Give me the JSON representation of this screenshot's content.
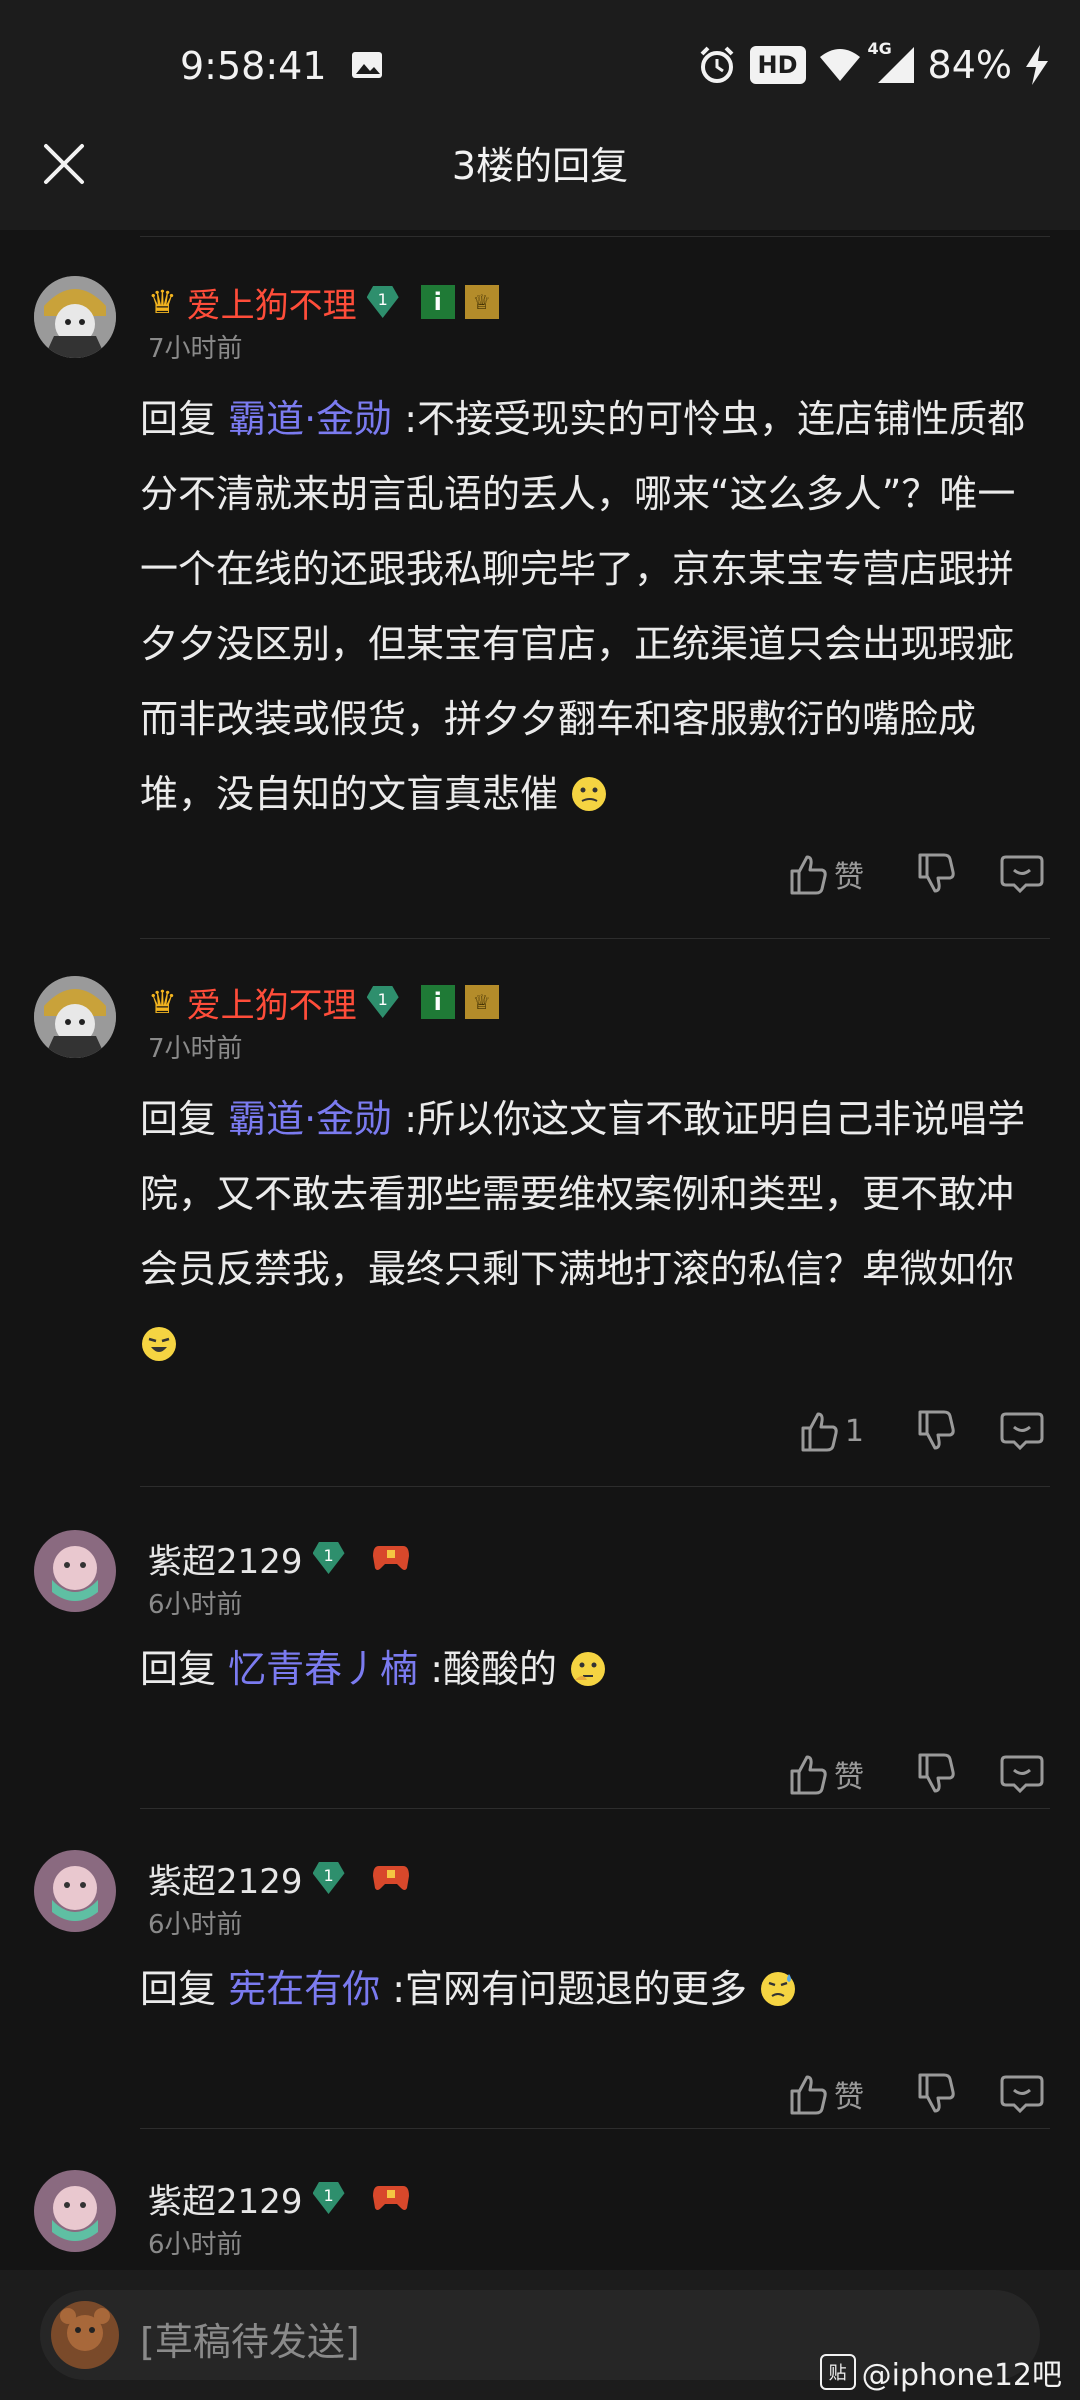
{
  "status_bar": {
    "time": "9:58:41",
    "hd": "HD",
    "net": "4G",
    "battery": "84%"
  },
  "header": {
    "title": "3楼的回复"
  },
  "posts": [
    {
      "username": "爱上狗不理",
      "time": "7小时前",
      "prefix": "回复 ",
      "mention": "霸道·金勋",
      "text": " :不接受现实的可怜虫，连店铺性质都分不清就来胡言乱语的丢人，哪来“这么多人”？唯一一个在线的还跟我私聊完毕了，京东某宝专营店跟拼夕夕没区别，但某宝有官店，正统渠道只会出现瑕疵而非改装或假货，拼夕夕翻车和客服敷衍的嘴脸成堆，没自知的文盲真悲催",
      "like_label": "赞"
    },
    {
      "username": "爱上狗不理",
      "time": "7小时前",
      "prefix": "回复 ",
      "mention": "霸道·金勋",
      "text": " :所以你这文盲不敢证明自己非说唱学院，又不敢去看那些需要维权案例和类型，更不敢冲会员反禁我，最终只剩下满地打滚的私信？卑微如你",
      "like_label": "1"
    },
    {
      "username": "紫超2129",
      "time": "6小时前",
      "prefix": "回复 ",
      "mention": "忆青春丿楠",
      "text": " :酸酸的",
      "like_label": "赞"
    },
    {
      "username": "紫超2129",
      "time": "6小时前",
      "prefix": "回复 ",
      "mention": "宪在有你",
      "text": " :官网有问题退的更多",
      "like_label": "赞"
    },
    {
      "username": "紫超2129",
      "time": "6小时前"
    }
  ],
  "badges": {
    "level": "1",
    "info": "i"
  },
  "input": {
    "placeholder": "[草稿待发送]"
  },
  "watermark": {
    "icon": "贴",
    "text": "@iphone12吧"
  },
  "colors": {
    "background": "#141414",
    "bar": "#1c1c1c",
    "username_red": "#ff4d3a",
    "mention": "#7b7bf0",
    "muted": "#8a8a8a"
  }
}
